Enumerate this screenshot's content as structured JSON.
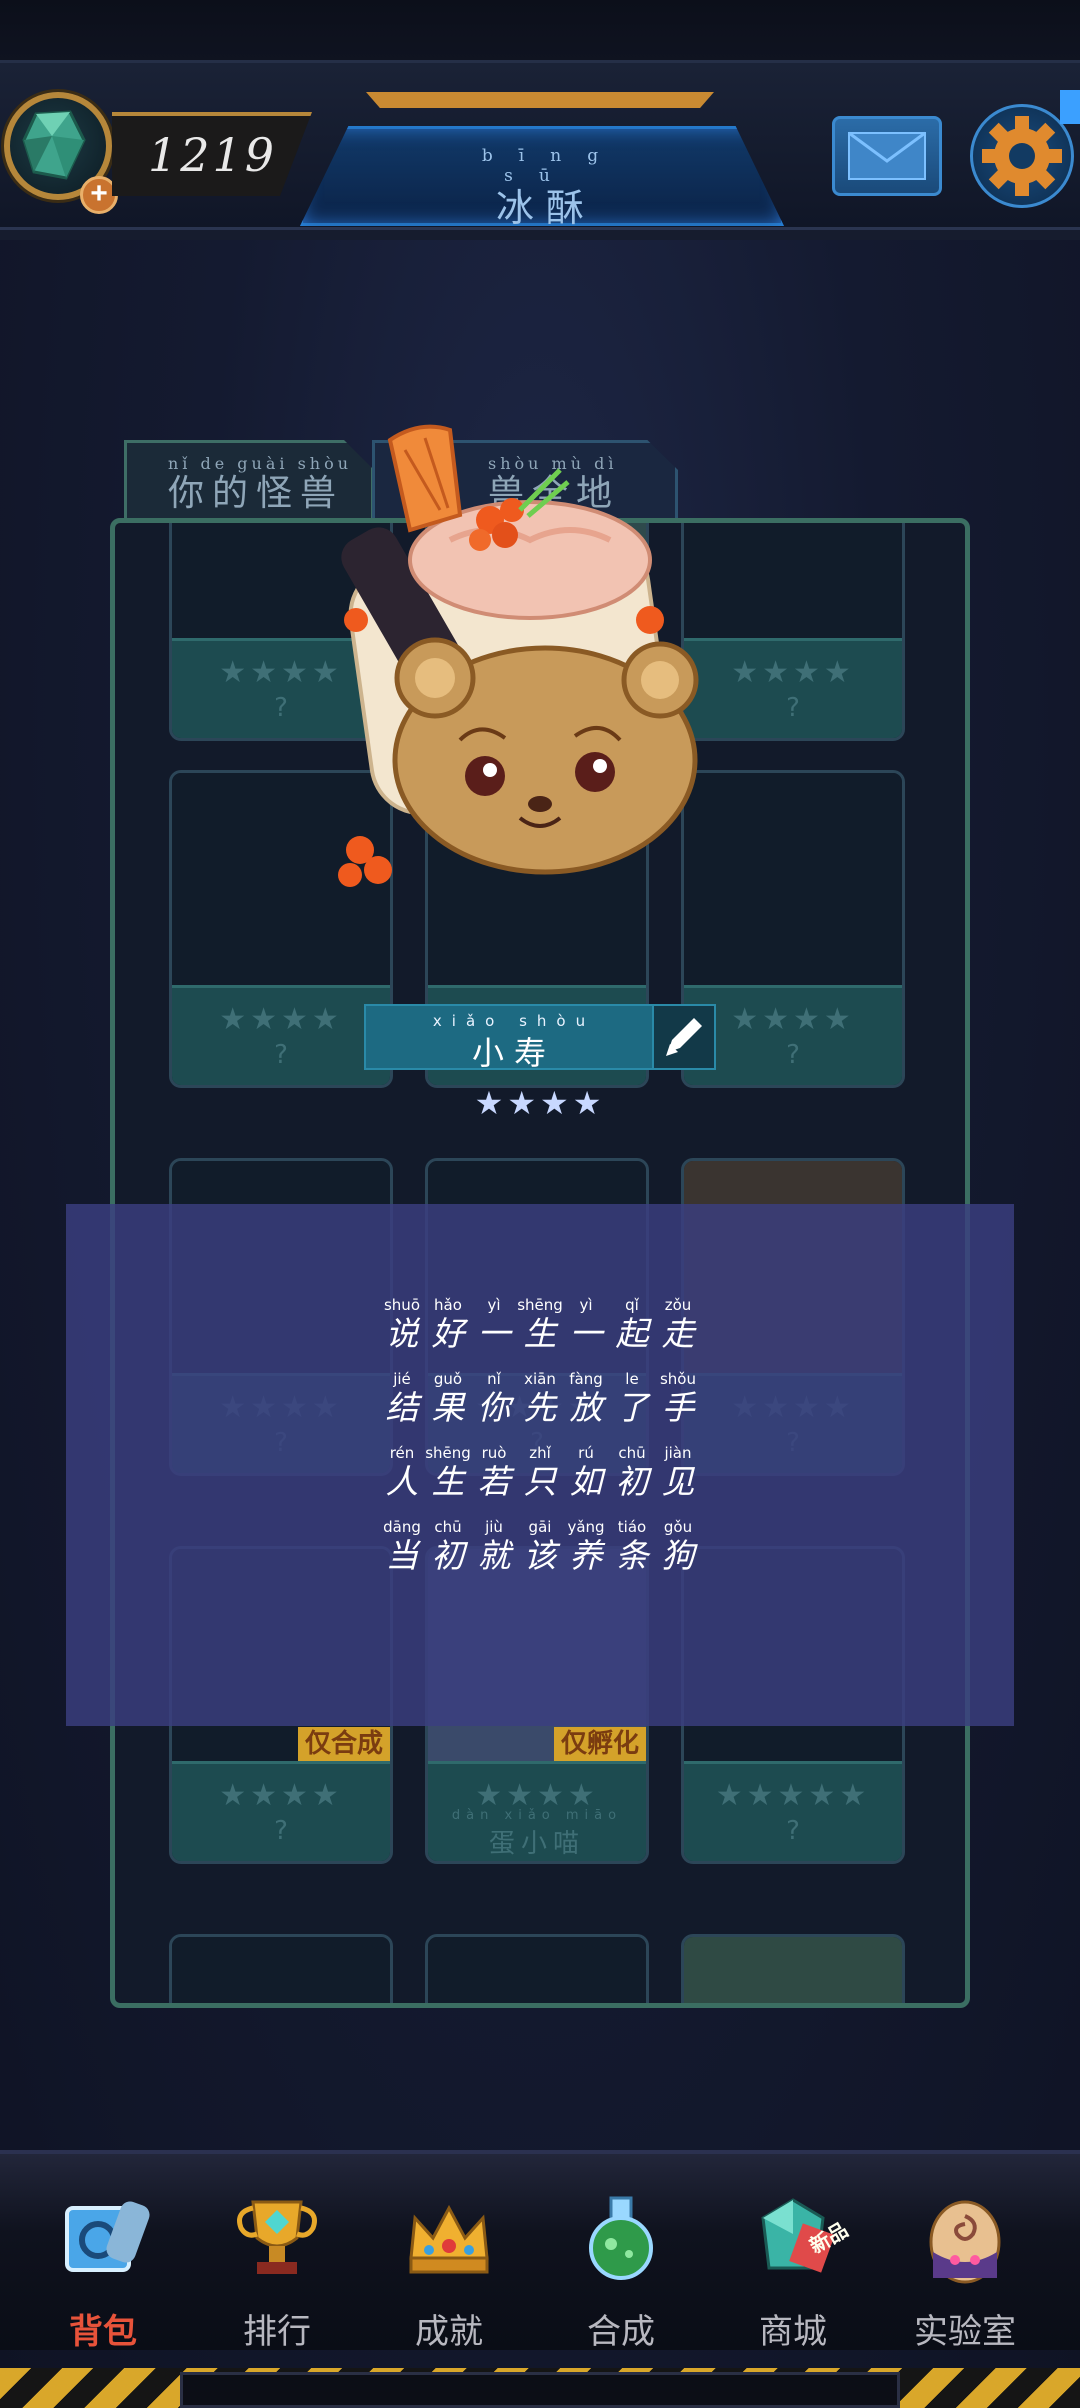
{
  "hud": {
    "gem_count": "1219",
    "gem_plus": "+",
    "title_pinyin": "bīng sū",
    "title": "冰酥"
  },
  "tabs": [
    {
      "pinyin": "nǐ de guài shòu",
      "label": "你的怪兽"
    },
    {
      "pinyin": "shòu mù dì",
      "label": "兽全地"
    }
  ],
  "cards": [
    {
      "stars": "★★★★",
      "name": "?"
    },
    {
      "stars": "★★★★",
      "name": "?"
    },
    {
      "stars": "★★★★",
      "name": "?"
    },
    {
      "stars": "★★★★",
      "name": "?"
    },
    {
      "stars": "★★★★",
      "name": "?"
    },
    {
      "stars": "★★★★",
      "name": "?"
    },
    {
      "stars": "★★★★",
      "name": "?"
    },
    {
      "stars": "★★★★",
      "name": "?"
    },
    {
      "stars": "★★★★",
      "name": "?"
    },
    {
      "stars": "★★★★",
      "name": "?",
      "badge": "仅合成"
    },
    {
      "stars": "★★★★",
      "name_pinyin": "dàn xiǎo miāo",
      "name": "蛋小喵",
      "badge": "仅孵化"
    },
    {
      "stars": "★★★★★",
      "name": "?"
    }
  ],
  "featured": {
    "name_pinyin": "xiǎo shòu",
    "name": "小寿",
    "stars": "★★★★",
    "star_count": 4
  },
  "poem": {
    "lines": [
      {
        "pinyin": [
          "shuō",
          "hǎo",
          "yì",
          "shēng",
          "yì",
          "qǐ",
          "zǒu"
        ],
        "chars": [
          "说",
          "好",
          "一",
          "生",
          "一",
          "起",
          "走"
        ]
      },
      {
        "pinyin": [
          "jié",
          "guǒ",
          "nǐ",
          "xiān",
          "fàng",
          "le",
          "shǒu"
        ],
        "chars": [
          "结",
          "果",
          "你",
          "先",
          "放",
          "了",
          "手"
        ]
      },
      {
        "pinyin": [
          "rén",
          "shēng",
          "ruò",
          "zhǐ",
          "rú",
          "chū",
          "jiàn"
        ],
        "chars": [
          "人",
          "生",
          "若",
          "只",
          "如",
          "初",
          "见"
        ]
      },
      {
        "pinyin": [
          "dāng",
          "chū",
          "jiù",
          "gāi",
          "yǎng",
          "tiáo",
          "gǒu"
        ],
        "chars": [
          "当",
          "初",
          "就",
          "该",
          "养",
          "条",
          "狗"
        ]
      }
    ]
  },
  "nav": [
    {
      "label": "背包",
      "icon": "backpack-icon",
      "active": true
    },
    {
      "label": "排行",
      "icon": "trophy-icon",
      "active": false
    },
    {
      "label": "成就",
      "icon": "crown-icon",
      "active": false
    },
    {
      "label": "合成",
      "icon": "potion-flask-icon",
      "active": false
    },
    {
      "label": "商城",
      "icon": "shop-crystal-icon",
      "active": false,
      "badge": "新品"
    },
    {
      "label": "实验室",
      "icon": "lab-egg-icon",
      "active": false
    }
  ],
  "colors": {
    "accent_active": "#e8533a",
    "panel_border": "#3b6e62",
    "title_blue": "#113a6a",
    "overlay": "#3a3e80"
  }
}
